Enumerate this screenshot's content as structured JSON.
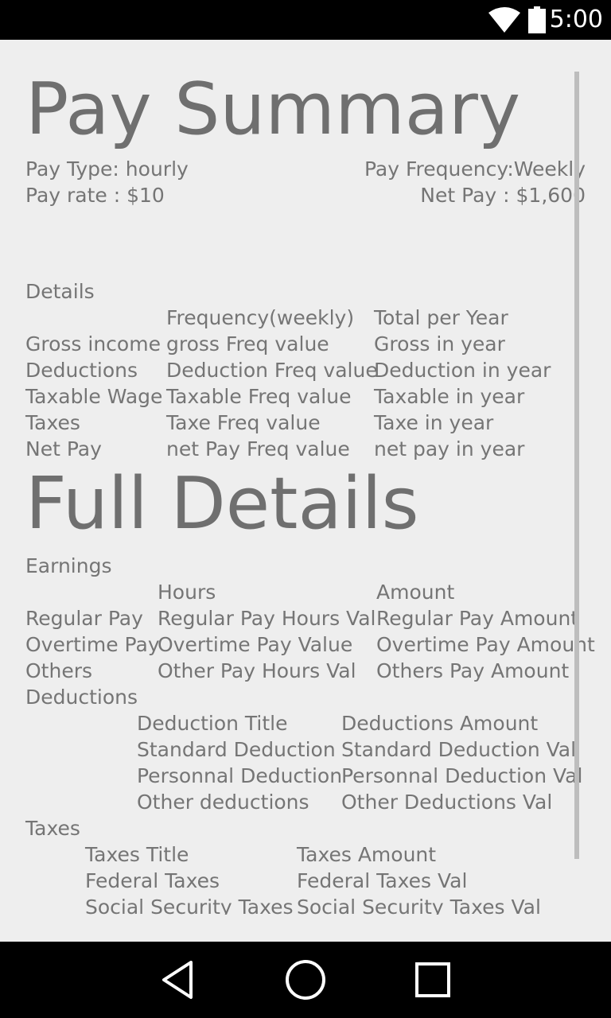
{
  "status_bar": {
    "time": "5:00",
    "wifi_icon": "wifi-icon",
    "battery_icon": "battery-icon"
  },
  "pay_summary": {
    "title": "Pay Summary",
    "pay_type": "Pay Type: hourly",
    "pay_frequency": "Pay Frequency:Weekly",
    "pay_rate": "Pay rate : $10",
    "net_pay": "Net Pay : $1,600"
  },
  "details": {
    "heading": "Details",
    "col_frequency": "Frequency(weekly)",
    "col_total": "Total per Year",
    "rows": [
      {
        "label": "Gross income",
        "freq": "gross Freq value",
        "year": "Gross in year"
      },
      {
        "label": "Deductions",
        "freq": "Deduction Freq value",
        "year": "Deduction in year"
      },
      {
        "label": "Taxable Wage",
        "freq": "Taxable Freq value",
        "year": "Taxable in year"
      },
      {
        "label": "Taxes",
        "freq": "Taxe Freq value",
        "year": "Taxe in year"
      },
      {
        "label": "Net Pay",
        "freq": "net Pay Freq value",
        "year": "net pay in year"
      }
    ]
  },
  "full_details": {
    "title": "Full Details",
    "earnings": {
      "heading": "Earnings",
      "col_hours": "Hours",
      "col_amount": "Amount",
      "rows": [
        {
          "label": "Regular Pay",
          "hours": "Regular Pay Hours Val",
          "amount": "Regular Pay Amount"
        },
        {
          "label": "Overtime Pay",
          "hours": "Overtime Pay Value",
          "amount": "Overtime Pay Amount"
        },
        {
          "label": "Others",
          "hours": "Other Pay Hours Val",
          "amount": "Others Pay Amount"
        }
      ]
    },
    "deductions": {
      "heading": "Deductions",
      "col_title": "Deduction Title",
      "col_amount": "Deductions Amount",
      "rows": [
        {
          "title": "Standard Deduction",
          "amount": "Standard Deduction Val"
        },
        {
          "title": "Personnal Deduction",
          "amount": "Personnal Deduction Val"
        },
        {
          "title": "Other deductions",
          "amount": "Other Deductions Val"
        }
      ]
    },
    "taxes": {
      "heading": "Taxes",
      "col_title": "Taxes Title",
      "col_amount": "Taxes Amount",
      "rows": [
        {
          "title": "Federal Taxes",
          "amount": "Federal Taxes Val"
        },
        {
          "title": "Social Security Taxes",
          "amount": "Social Security Taxes Val"
        }
      ]
    }
  },
  "nav_bar": {
    "back_icon": "back-icon",
    "home_icon": "home-icon",
    "recents_icon": "recents-icon"
  }
}
